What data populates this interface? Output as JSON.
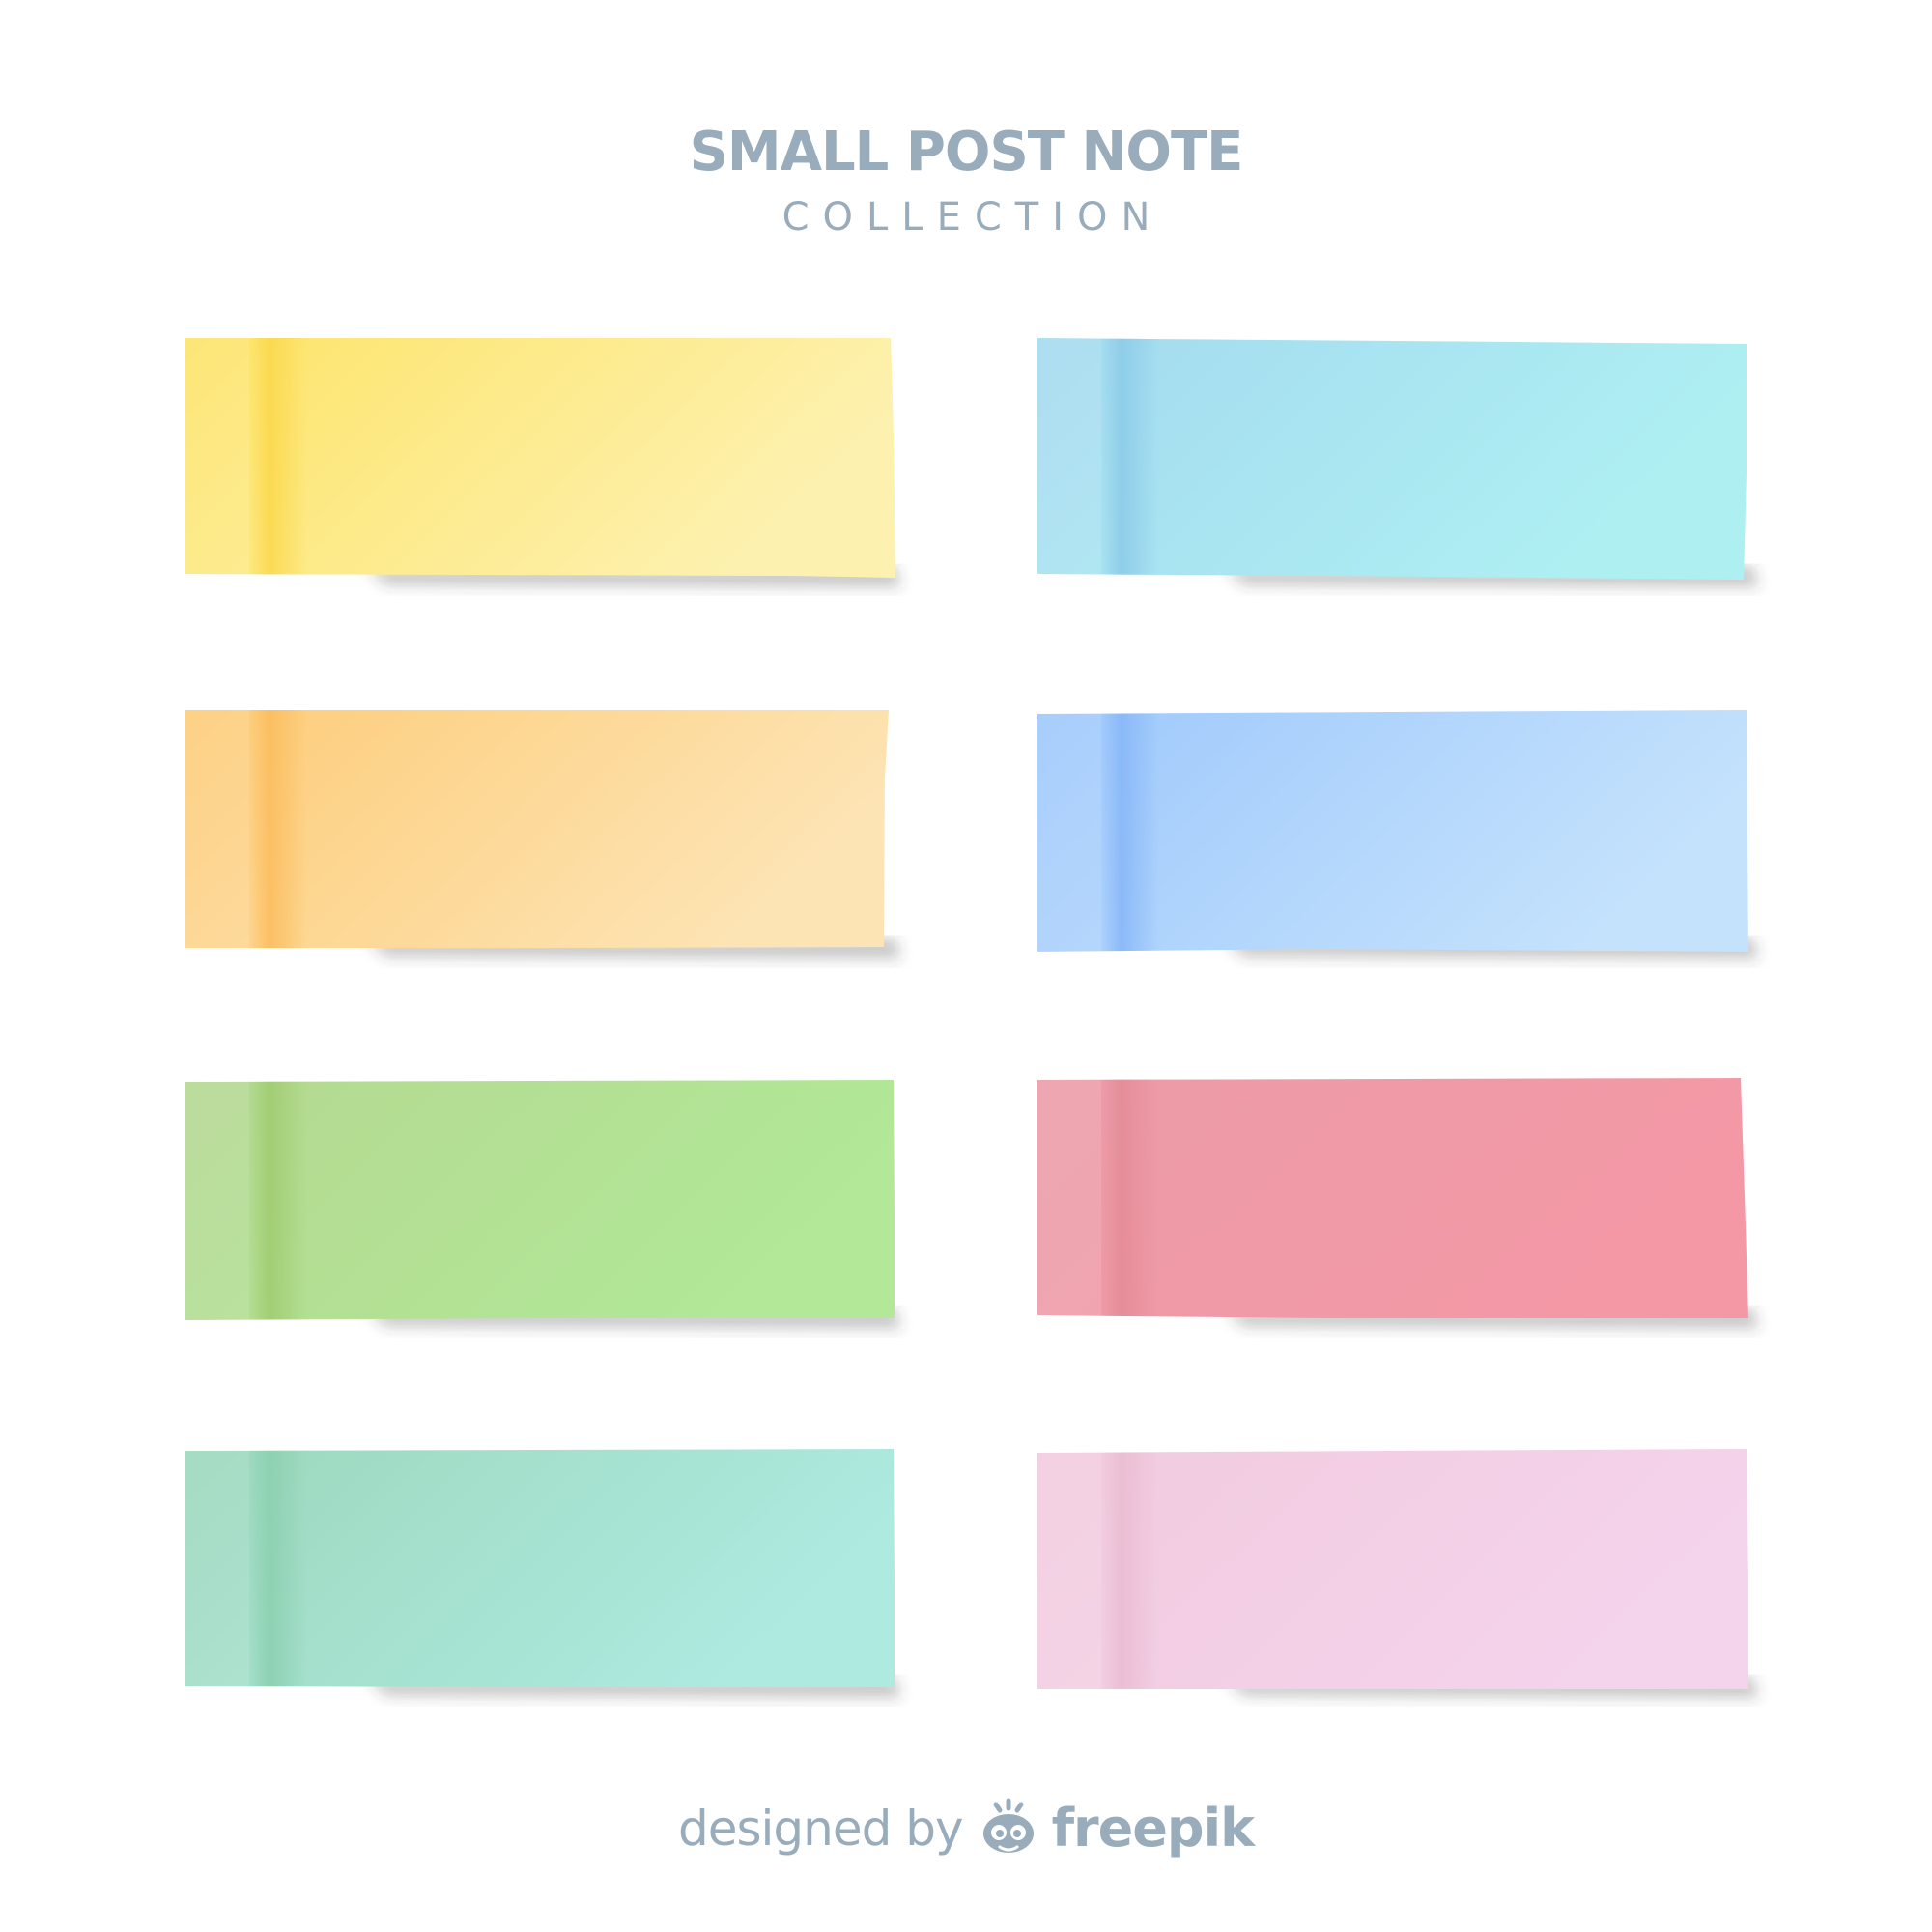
{
  "heading": {
    "title": "SMALL POST NOTE",
    "subtitle": "COLLECTION"
  },
  "notes": [
    {
      "name": "note-yellow",
      "colors": {
        "left": "#fde468",
        "right": "#fdf1b0",
        "strip": "#fbd84d"
      }
    },
    {
      "name": "note-sky-blue",
      "colors": {
        "left": "#a4daf0",
        "right": "#aef0f2",
        "strip": "#8ccbe8"
      }
    },
    {
      "name": "note-orange",
      "colors": {
        "left": "#fdcc78",
        "right": "#fde4b4",
        "strip": "#fbbd5e"
      }
    },
    {
      "name": "note-periwinkle",
      "colors": {
        "left": "#9ec8fc",
        "right": "#c4e2fc",
        "strip": "#88b7f8"
      }
    },
    {
      "name": "note-green",
      "colors": {
        "left": "#b4d890",
        "right": "#b2e898",
        "strip": "#a0cc70"
      }
    },
    {
      "name": "note-pink-red",
      "colors": {
        "left": "#ec9ca8",
        "right": "#f498a6",
        "strip": "#e48c98"
      }
    },
    {
      "name": "note-mint",
      "colors": {
        "left": "#9cd8bc",
        "right": "#aeeae0",
        "strip": "#8ccfb0"
      }
    },
    {
      "name": "note-light-pink",
      "colors": {
        "left": "#f2cbde",
        "right": "#f4d3ec",
        "strip": "#eabcd2"
      }
    }
  ],
  "credit": {
    "prefix": "designed by",
    "brand": "freepik",
    "icon": "freepik-logo-icon",
    "color": "#98acbc"
  }
}
